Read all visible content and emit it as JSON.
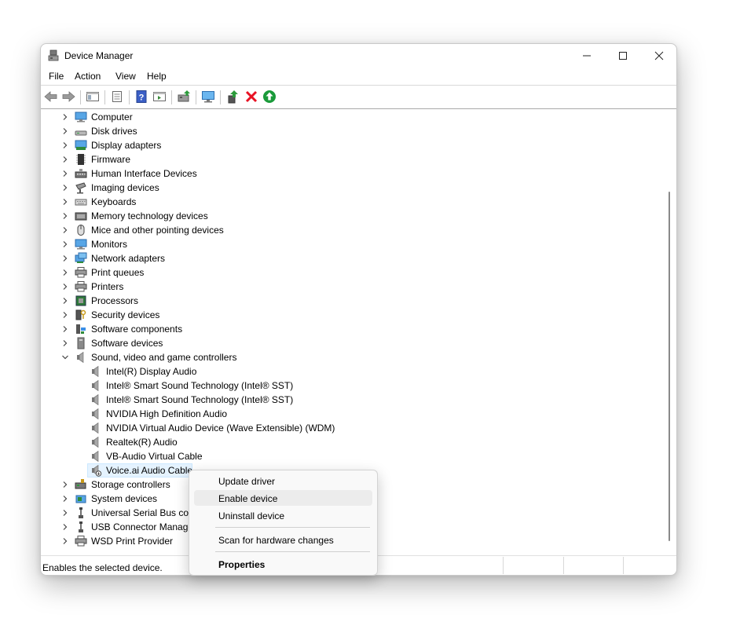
{
  "window": {
    "title": "Device Manager",
    "app_icon": "device-manager-icon",
    "controls": {
      "minimize": "minimize-icon",
      "maximize": "maximize-icon",
      "close": "close-icon"
    }
  },
  "menubar": {
    "items": [
      "File",
      "Action",
      "Help"
    ],
    "view": "View"
  },
  "toolbar": {
    "buttons": [
      "back-icon",
      "forward-icon",
      "show-hide-console-tree-icon",
      "properties-icon",
      "help-icon",
      "action-pane-icon",
      "update-driver-icon",
      "scan-hardware-icon",
      "enable-device-icon",
      "uninstall-icon",
      "enable-green-icon"
    ]
  },
  "tree": {
    "items": [
      {
        "label": "Computer",
        "icon": "computer-icon",
        "expanded": false,
        "level": 0
      },
      {
        "label": "Disk drives",
        "icon": "disk-drive-icon",
        "expanded": false,
        "level": 0
      },
      {
        "label": "Display adapters",
        "icon": "display-adapter-icon",
        "expanded": false,
        "level": 0
      },
      {
        "label": "Firmware",
        "icon": "firmware-icon",
        "expanded": false,
        "level": 0
      },
      {
        "label": "Human Interface Devices",
        "icon": "hid-icon",
        "expanded": false,
        "level": 0
      },
      {
        "label": "Imaging devices",
        "icon": "camera-icon",
        "expanded": false,
        "level": 0
      },
      {
        "label": "Keyboards",
        "icon": "keyboard-icon",
        "expanded": false,
        "level": 0
      },
      {
        "label": "Memory technology devices",
        "icon": "memory-icon",
        "expanded": false,
        "level": 0
      },
      {
        "label": "Mice and other pointing devices",
        "icon": "mouse-icon",
        "expanded": false,
        "level": 0
      },
      {
        "label": "Monitors",
        "icon": "monitor-icon",
        "expanded": false,
        "level": 0
      },
      {
        "label": "Network adapters",
        "icon": "network-adapter-icon",
        "expanded": false,
        "level": 0
      },
      {
        "label": "Print queues",
        "icon": "printer-icon",
        "expanded": false,
        "level": 0
      },
      {
        "label": "Printers",
        "icon": "printer-icon",
        "expanded": false,
        "level": 0
      },
      {
        "label": "Processors",
        "icon": "processor-icon",
        "expanded": false,
        "level": 0
      },
      {
        "label": "Security devices",
        "icon": "security-key-icon",
        "expanded": false,
        "level": 0
      },
      {
        "label": "Software components",
        "icon": "software-component-icon",
        "expanded": false,
        "level": 0
      },
      {
        "label": "Software devices",
        "icon": "software-device-icon",
        "expanded": false,
        "level": 0
      },
      {
        "label": "Sound, video and game controllers",
        "icon": "speaker-icon",
        "expanded": true,
        "level": 0
      },
      {
        "label": "Intel(R) Display Audio",
        "icon": "speaker-icon",
        "level": 1
      },
      {
        "label": "Intel® Smart Sound Technology (Intel® SST)",
        "icon": "speaker-icon",
        "level": 1
      },
      {
        "label": "Intel® Smart Sound Technology (Intel® SST)",
        "icon": "speaker-icon",
        "level": 1
      },
      {
        "label": "NVIDIA High Definition Audio",
        "icon": "speaker-icon",
        "level": 1
      },
      {
        "label": "NVIDIA Virtual Audio Device (Wave Extensible) (WDM)",
        "icon": "speaker-icon",
        "level": 1
      },
      {
        "label": "Realtek(R) Audio",
        "icon": "speaker-icon",
        "level": 1
      },
      {
        "label": "VB-Audio Virtual Cable",
        "icon": "speaker-icon",
        "level": 1
      },
      {
        "label": "Voice.ai Audio Cable",
        "icon": "speaker-disabled-icon",
        "level": 1,
        "selected": true
      },
      {
        "label": "Storage controllers",
        "icon": "storage-controller-icon",
        "expanded": false,
        "level": 0
      },
      {
        "label": "System devices",
        "icon": "system-devices-icon",
        "expanded": false,
        "level": 0
      },
      {
        "label": "Universal Serial Bus con",
        "icon": "usb-icon",
        "expanded": false,
        "level": 0
      },
      {
        "label": "USB Connector Manage",
        "icon": "usb-icon",
        "expanded": false,
        "level": 0
      },
      {
        "label": "WSD Print Provider",
        "icon": "printer-icon",
        "expanded": false,
        "level": 0
      }
    ]
  },
  "context_menu": {
    "update_driver": "Update driver",
    "enable_device": "Enable device",
    "uninstall_device": "Uninstall device",
    "scan": "Scan for hardware changes",
    "properties": "Properties"
  },
  "statusbar": {
    "text": "Enables the selected device."
  },
  "colors": {
    "selection_bg": "#e5f3ff",
    "accent_blue": "#3a8ee6",
    "stop_red": "#e81123",
    "go_green": "#1a9a3a"
  }
}
